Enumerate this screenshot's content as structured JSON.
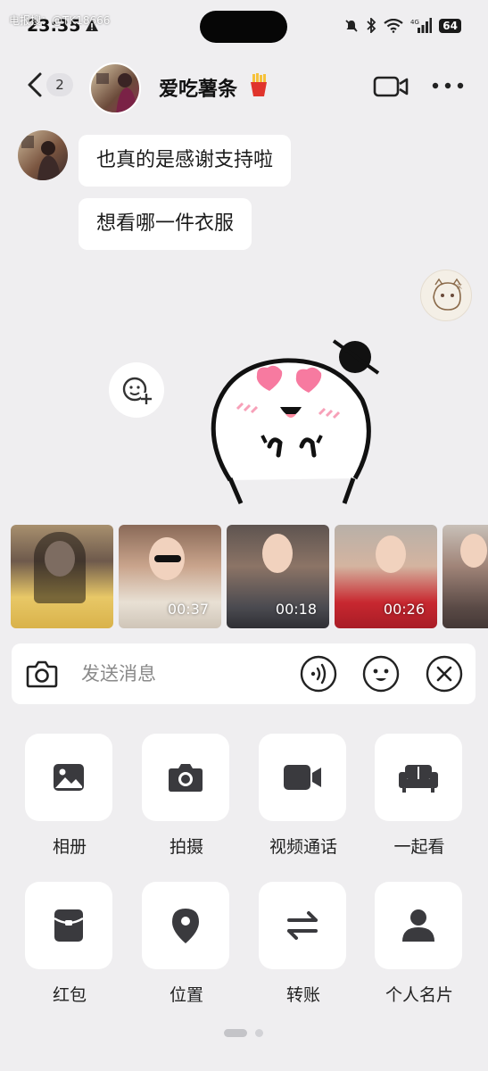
{
  "status_bar": {
    "time": "23:35",
    "watermark": "电报搜：@TK18666",
    "battery": "64",
    "network": "4G"
  },
  "header": {
    "unread_count": "2",
    "contact_name": "爱吃薯条",
    "name_emoji_icon": "fries-icon"
  },
  "messages": [
    {
      "sender": "contact",
      "text": "也真的是感谢支持啦"
    },
    {
      "sender": "contact",
      "text": "想看哪一件衣服"
    },
    {
      "sender": "me",
      "type": "sticker",
      "icon": "heart-eyes-sticker"
    }
  ],
  "thumbnails": [
    {
      "duration": ""
    },
    {
      "duration": "00:37"
    },
    {
      "duration": "00:18"
    },
    {
      "duration": "00:26"
    },
    {
      "duration": ""
    }
  ],
  "input": {
    "placeholder": "发送消息"
  },
  "panel": {
    "items": [
      {
        "label": "相册",
        "icon": "photo-album-icon"
      },
      {
        "label": "拍摄",
        "icon": "camera-icon"
      },
      {
        "label": "视频通话",
        "icon": "video-call-icon"
      },
      {
        "label": "一起看",
        "icon": "sofa-icon"
      },
      {
        "label": "红包",
        "icon": "red-packet-icon"
      },
      {
        "label": "位置",
        "icon": "location-pin-icon"
      },
      {
        "label": "转账",
        "icon": "transfer-icon"
      },
      {
        "label": "个人名片",
        "icon": "person-card-icon"
      }
    ],
    "page_index": 1,
    "page_count": 2
  },
  "colors": {
    "background": "#efeef0",
    "bubble": "#ffffff",
    "icon": "#3a3a3e",
    "sticker_heart": "#f77aa0"
  }
}
